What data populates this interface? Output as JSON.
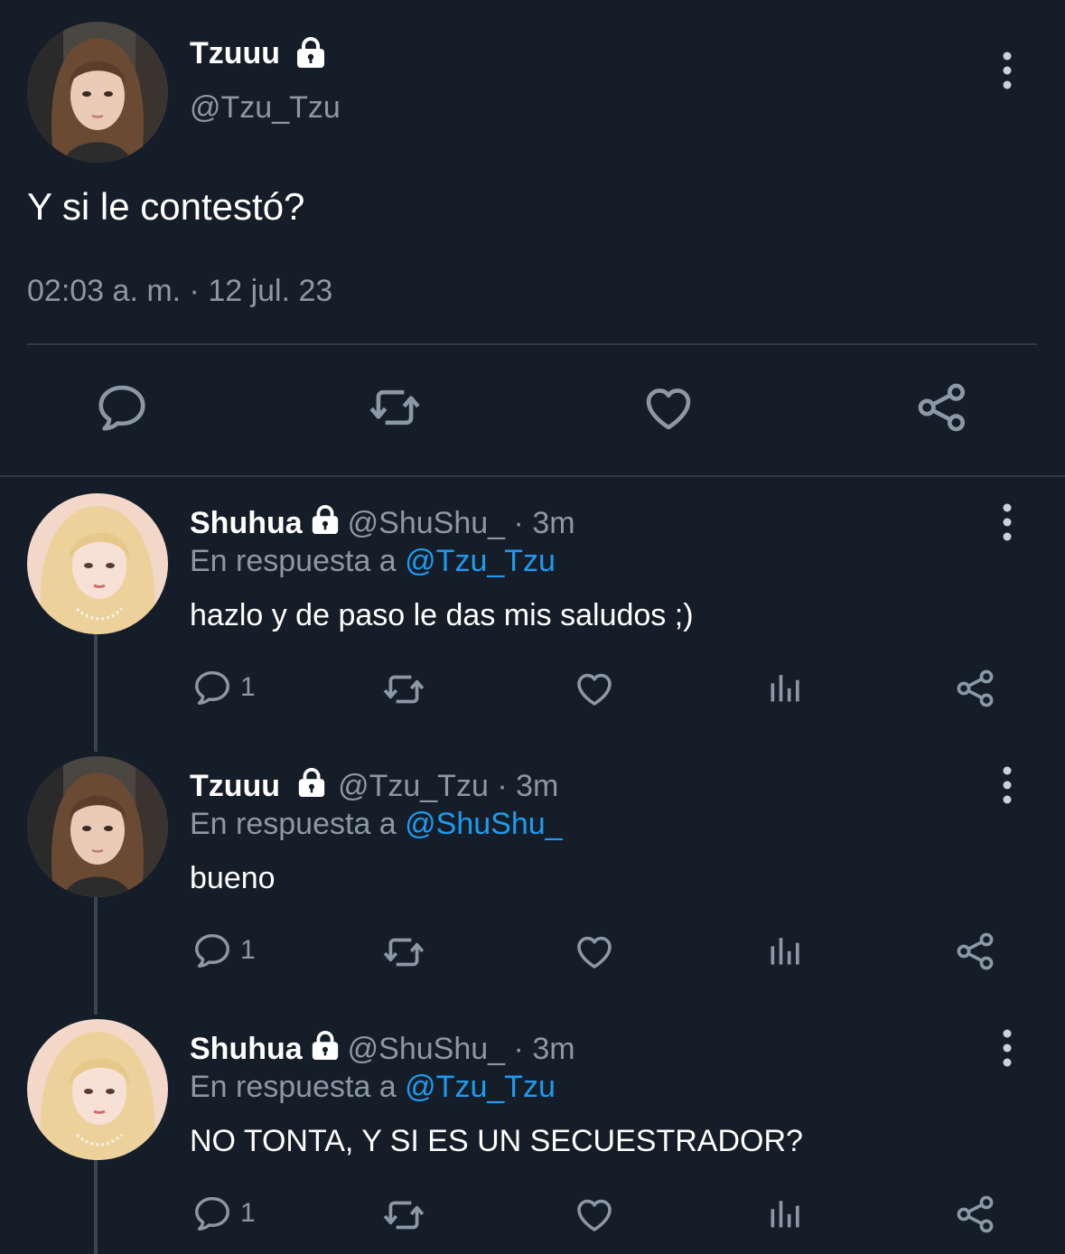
{
  "main_tweet": {
    "author_name": "Tzuuu",
    "author_handle": "@Tzu_Tzu",
    "text": "Y si le contestó?",
    "timestamp": "02:03 a. m. · 12 jul. 23",
    "actions": [
      "reply-icon",
      "retweet-icon",
      "like-icon",
      "share-icon"
    ]
  },
  "replies": [
    {
      "author_name": "Shuhua",
      "author_handle": "@ShuShu_",
      "time": "· 3m",
      "reply_prefix": "En respuesta a",
      "reply_to": "@Tzu_Tzu",
      "text": "hazlo y de paso le das mis saludos ;)",
      "reply_count": "1"
    },
    {
      "author_name": "Tzuuu",
      "author_handle": "@Tzu_Tzu",
      "time": "· 3m",
      "reply_prefix": "En respuesta a",
      "reply_to": "@ShuShu_",
      "text": "bueno",
      "reply_count": "1"
    },
    {
      "author_name": "Shuhua",
      "author_handle": "@ShuShu_",
      "time": "· 3m",
      "reply_prefix": "En respuesta a",
      "reply_to": "@Tzu_Tzu",
      "text": "NO TONTA, Y SI ES UN SECUESTRADOR?",
      "reply_count": "1"
    }
  ],
  "colors": {
    "background": "#151d28",
    "secondary_text": "#8b98a5",
    "mention": "#1d9bf0",
    "divider": "#2e3a47",
    "icon": "#8b98a5"
  }
}
